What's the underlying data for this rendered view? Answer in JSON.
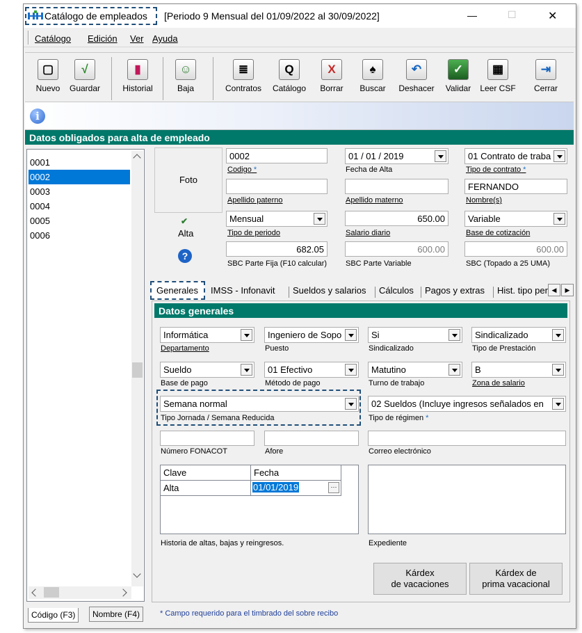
{
  "window": {
    "app_title": "Catálogo de empleados",
    "period": "[Periodo 9 Mensual del 01/09/2022 al 30/09/2022]",
    "min_glyph": "—",
    "max_glyph": "☐",
    "close_glyph": "✕"
  },
  "menu": [
    "Catálogo",
    "Edición",
    "Ver",
    "Ayuda"
  ],
  "toolbar": [
    {
      "label": "Nuevo",
      "icon": "new-document-icon",
      "glyph": "▢"
    },
    {
      "label": "Guardar",
      "icon": "save-check-icon",
      "glyph": "√"
    },
    {
      "label": "Historial",
      "icon": "history-icon",
      "glyph": "▮"
    },
    {
      "label": "Baja",
      "icon": "deactivate-icon",
      "glyph": "☺"
    },
    {
      "label": "Contratos",
      "icon": "printer-icon",
      "glyph": "≣"
    },
    {
      "label": "Catálogo",
      "icon": "catalog-preview-icon",
      "glyph": "Q"
    },
    {
      "label": "Borrar",
      "icon": "delete-x-icon",
      "glyph": "X"
    },
    {
      "label": "Buscar",
      "icon": "binoculars-icon",
      "glyph": "♠"
    },
    {
      "label": "Deshacer",
      "icon": "undo-icon",
      "glyph": "↶"
    },
    {
      "label": "Validar",
      "icon": "sat-validate-icon",
      "glyph": "✓"
    },
    {
      "label": "Leer CSF",
      "icon": "qr-icon",
      "glyph": "▦"
    },
    {
      "label": "Cerrar",
      "icon": "exit-icon",
      "glyph": "⇥"
    }
  ],
  "info_glyph": "i",
  "section_title": "Datos obligados para alta de empleado",
  "employee_list": [
    "0001",
    "0002",
    "0003",
    "0004",
    "0005",
    "0006"
  ],
  "selected_employee": "0002",
  "bottom_tabs": [
    "Código (F3)",
    "Nombre (F4)"
  ],
  "form": {
    "foto": "Foto",
    "alta": "Alta",
    "codigo": {
      "value": "0002",
      "label": "Codigo",
      "req": " *"
    },
    "fecha_alta": {
      "value": "01 / 01 / 2019",
      "label": "Fecha de Alta"
    },
    "tipo_contrato": {
      "value": "01 Contrato de traba",
      "label": "Tipo de contrato",
      "req": " *"
    },
    "apellido_paterno": {
      "value": "",
      "label": "Apellido paterno"
    },
    "apellido_materno": {
      "value": "",
      "label": "Apellido materno"
    },
    "nombre": {
      "value": "FERNANDO",
      "label": "Nombre(s)"
    },
    "tipo_periodo": {
      "value": "Mensual",
      "label": "Tipo de periodo"
    },
    "salario_diario": {
      "value": "650.00",
      "label": "Salario diario"
    },
    "base_cotizacion": {
      "value": "Variable",
      "label": "Base de cotización"
    },
    "sbc_fija": {
      "value": "682.05",
      "label": "SBC Parte Fija  (F10 calcular)"
    },
    "sbc_variable": {
      "value": "600.00",
      "label": "SBC Parte Variable"
    },
    "sbc_topado": {
      "value": "600.00",
      "label": "SBC (Topado a 25 UMA)"
    }
  },
  "tabs": [
    "Generales",
    "IMSS - Infonavit",
    "Sueldos y salarios",
    "Cálculos",
    "Pagos y extras",
    "Hist. tipo perio"
  ],
  "generales": {
    "title": "Datos generales",
    "departamento": {
      "value": "Informática",
      "label": "Departamento"
    },
    "puesto": {
      "value": "Ingeniero de Sopo",
      "label": "Puesto"
    },
    "sindicalizado": {
      "value": "Si",
      "label": "Sindicalizado"
    },
    "tipo_prestacion": {
      "value": "Sindicalizado",
      "label": "Tipo de Prestación"
    },
    "base_pago": {
      "value": "Sueldo",
      "label": "Base de pago"
    },
    "metodo_pago": {
      "value": "01 Efectivo",
      "label": "Método de pago"
    },
    "turno": {
      "value": "Matutino",
      "label": "Turno de trabajo"
    },
    "zona_salario": {
      "value": "B",
      "label": "Zona de salario"
    },
    "tipo_jornada": {
      "value": "Semana normal",
      "label": "Tipo Jornada / Semana Reducida"
    },
    "tipo_regimen": {
      "value": "02 Sueldos (Incluye ingresos señalados en",
      "label": "Tipo de régimen",
      "req": " *"
    },
    "fonacot": {
      "value": "",
      "label": "Número FONACOT"
    },
    "afore": {
      "value": "",
      "label": "Afore"
    },
    "correo": {
      "value": "",
      "label": "Correo electrónico"
    },
    "historia": {
      "headers": [
        "Clave",
        "Fecha"
      ],
      "row": [
        "Alta",
        "01/01/2019"
      ],
      "ellipsis": "···",
      "label": "Historia de altas, bajas y reingresos."
    },
    "expediente": "Expediente",
    "kardex_vac": [
      "Kárdex",
      "de vacaciones"
    ],
    "kardex_prima": [
      "Kárdex de",
      "prima vacacional"
    ]
  },
  "footnote": "* Campo requerido para el timbrado del sobre recibo"
}
